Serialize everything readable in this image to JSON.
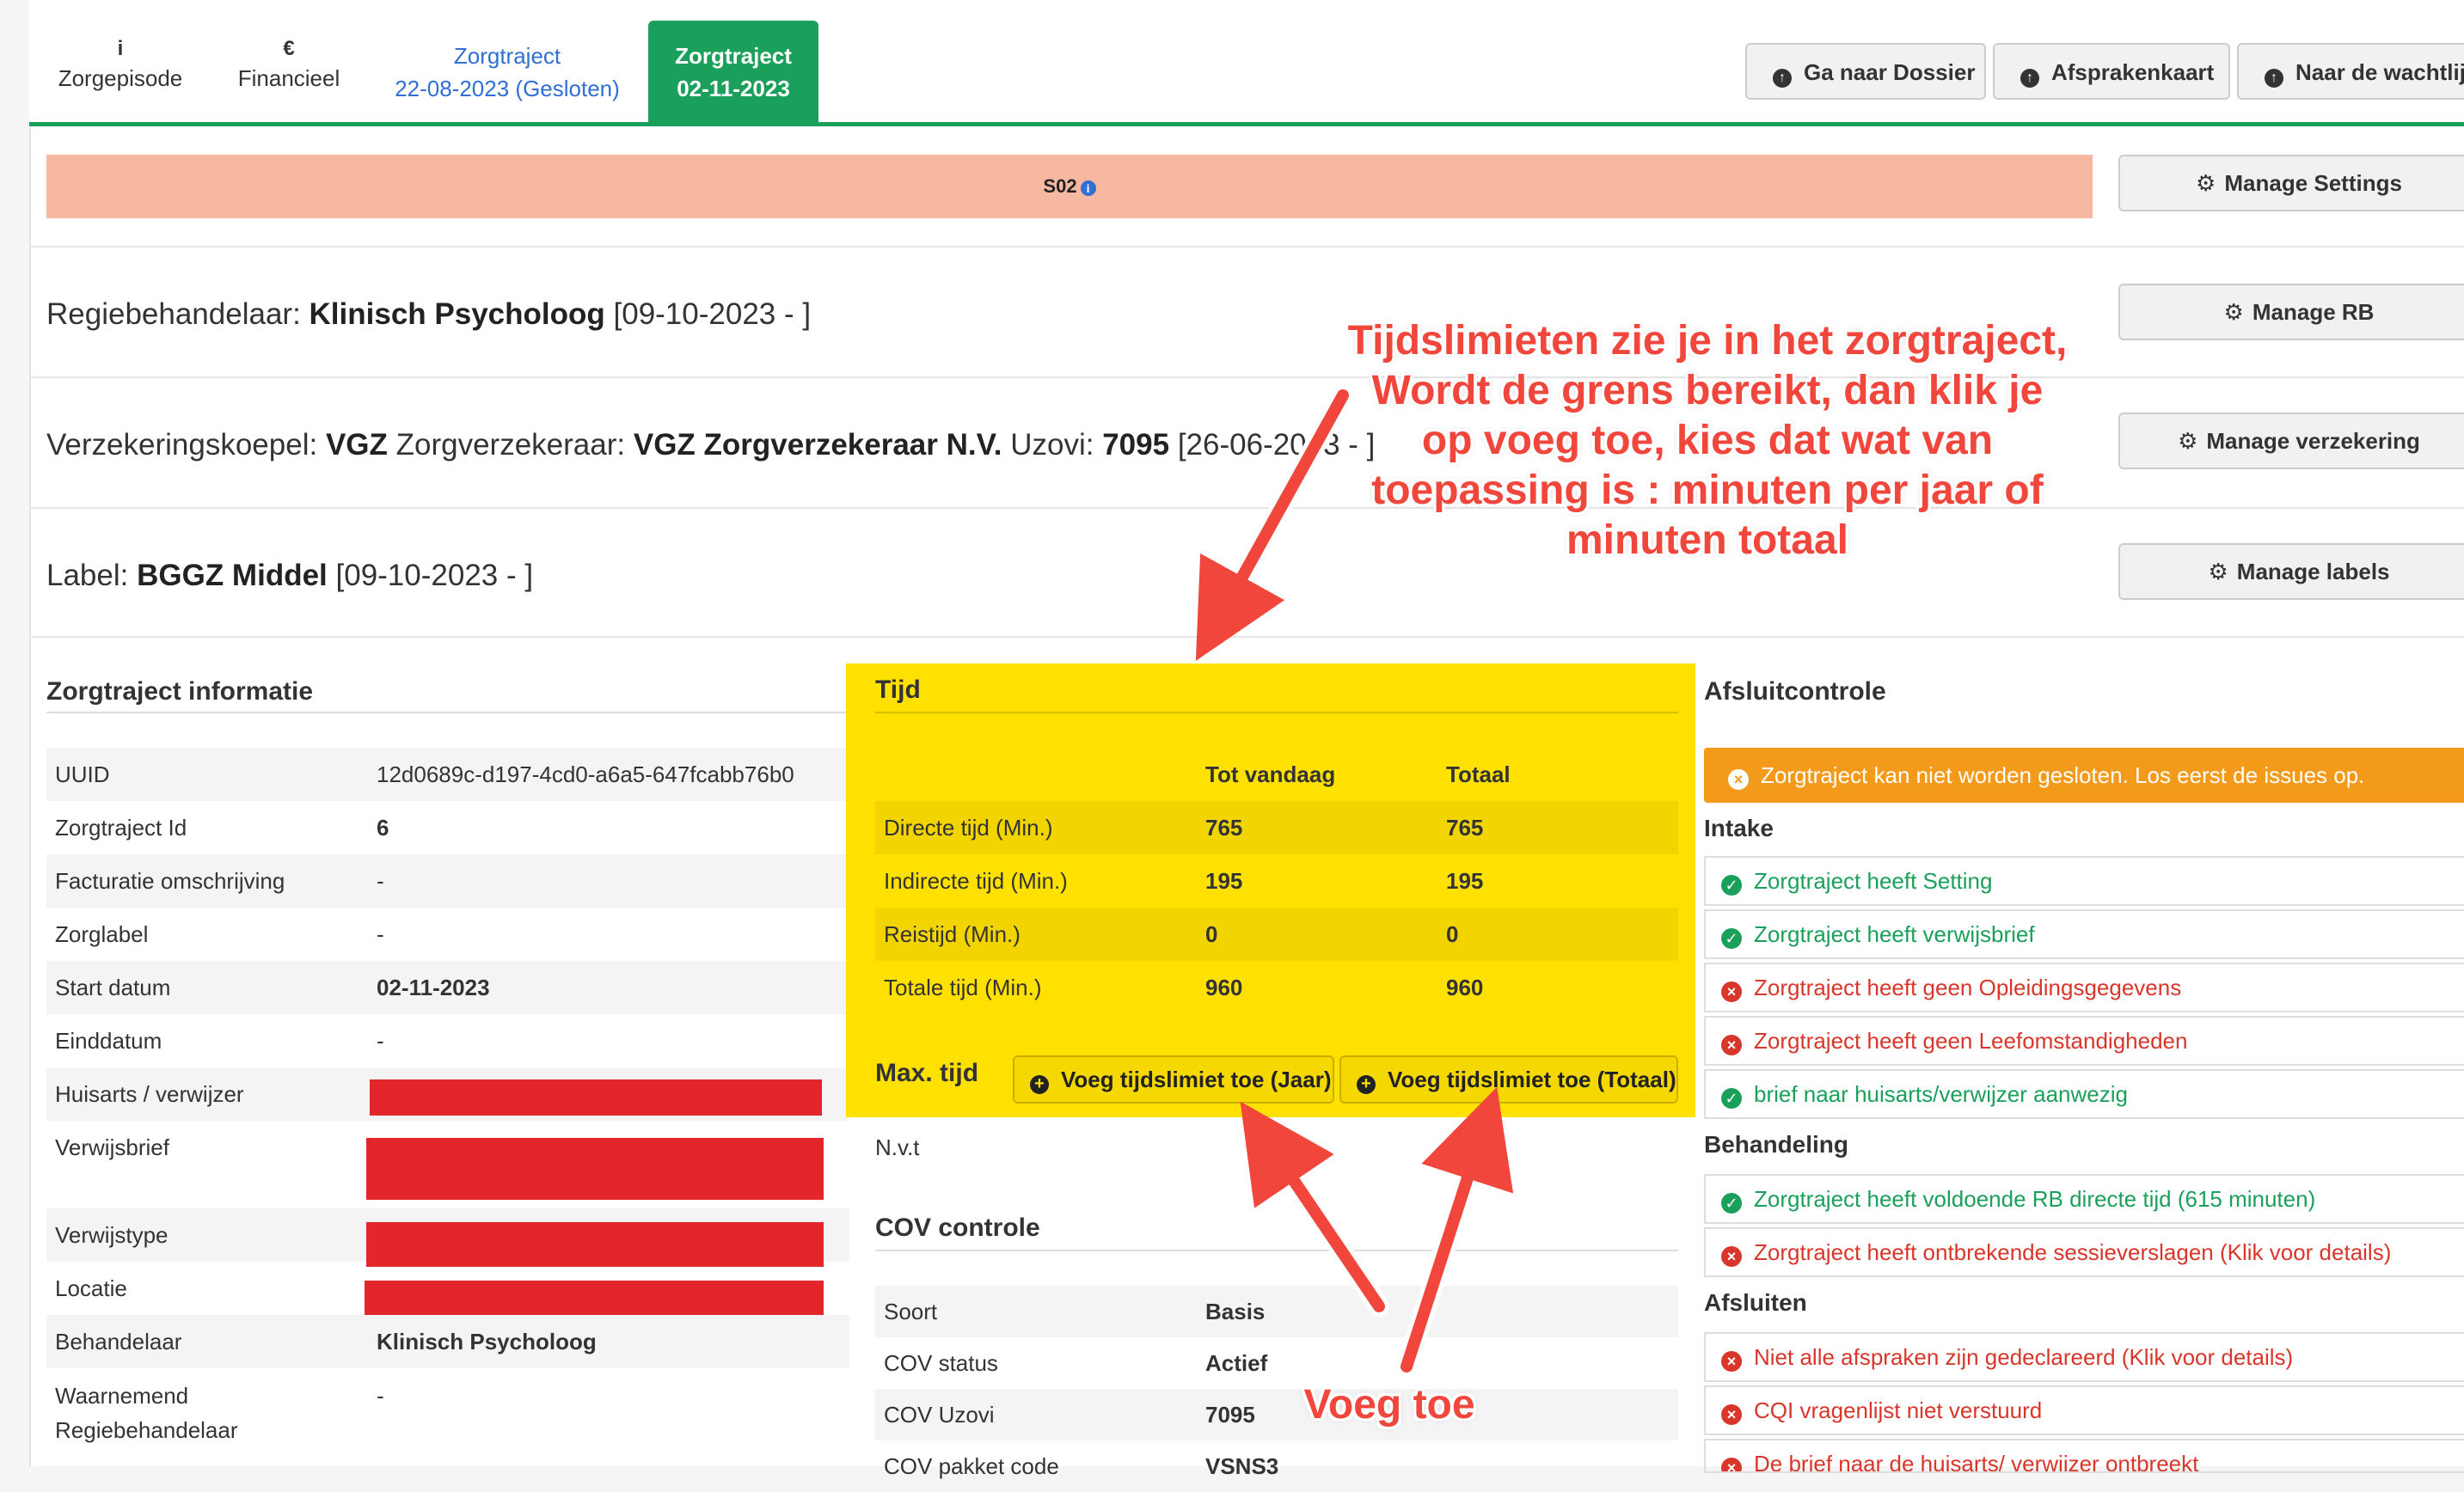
{
  "tabs": {
    "zorgepisode": {
      "icon": "i",
      "label": "Zorgepisode"
    },
    "financieel": {
      "icon": "€",
      "label": "Financieel"
    },
    "zorgtraject_old": {
      "line1": "Zorgtraject",
      "line2": "22-08-2023 (Gesloten)"
    },
    "zorgtraject_active": {
      "line1": "Zorgtraject",
      "line2": "02-11-2023"
    }
  },
  "top_buttons": {
    "dossier": "Ga naar Dossier",
    "afspraken": "Afsprakenkaart",
    "wachtlijst": "Naar de wachtlijst"
  },
  "setting_badge": "S02",
  "manage": {
    "settings": "Manage Settings",
    "rb": "Manage RB",
    "verzekering": "Manage verzekering",
    "labels": "Manage labels"
  },
  "regie": {
    "label": "Regiebehandelaar:",
    "value": "Klinisch Psycholoog",
    "date": "[09-10-2023 - ]"
  },
  "verzekering": {
    "koepel_label": "Verzekeringskoepel:",
    "koepel": "VGZ",
    "verz_label": "Zorgverzekeraar:",
    "verz": "VGZ Zorgverzekeraar N.V.",
    "uzovi_label": "Uzovi:",
    "uzovi": "7095",
    "date": "[26-06-2023 - ]"
  },
  "label": {
    "label": "Label:",
    "value": "BGGZ Middel",
    "date": "[09-10-2023 - ]"
  },
  "zorgtraject_info": {
    "title": "Zorgtraject informatie",
    "rows": [
      {
        "k": "UUID",
        "v": "12d0689c-d197-4cd0-a6a5-647fcabb76b0"
      },
      {
        "k": "Zorgtraject Id",
        "v": "6"
      },
      {
        "k": "Facturatie omschrijving",
        "v": "-"
      },
      {
        "k": "Zorglabel",
        "v": "-"
      },
      {
        "k": "Start datum",
        "v": "02-11-2023"
      },
      {
        "k": "Einddatum",
        "v": "-"
      },
      {
        "k": "Huisarts / verwijzer",
        "v": ""
      },
      {
        "k": "Verwijsbrief",
        "v": ""
      },
      {
        "k": "Verwijstype",
        "v": ""
      },
      {
        "k": "Locatie",
        "v": ""
      },
      {
        "k": "Behandelaar",
        "v": "Klinisch Psycholoog"
      },
      {
        "k": "Waarnemend",
        "k2": "Regiebehandelaar",
        "v": "-"
      }
    ]
  },
  "tijd": {
    "title": "Tijd",
    "head": {
      "c1": "Tot vandaag",
      "c2": "Totaal"
    },
    "rows": [
      {
        "k": "Directe tijd (Min.)",
        "c1": "765",
        "c2": "765"
      },
      {
        "k": "Indirecte tijd (Min.)",
        "c1": "195",
        "c2": "195"
      },
      {
        "k": "Reistijd (Min.)",
        "c1": "0",
        "c2": "0"
      },
      {
        "k": "Totale tijd (Min.)",
        "c1": "960",
        "c2": "960"
      }
    ],
    "max_label": "Max. tijd",
    "btn_jaar": "Voeg tijdslimiet toe (Jaar)",
    "btn_totaal": "Voeg tijdslimiet toe (Totaal)",
    "nvt": "N.v.t"
  },
  "cov": {
    "title": "COV controle",
    "rows": [
      {
        "k": "Soort",
        "v": "Basis"
      },
      {
        "k": "COV status",
        "v": "Actief"
      },
      {
        "k": "COV Uzovi",
        "v": "7095"
      },
      {
        "k": "COV pakket code",
        "v": "VSNS3"
      }
    ]
  },
  "afsluit": {
    "title": "Afsluitcontrole",
    "alert": "Zorgtraject kan niet worden gesloten. Los eerst de issues op.",
    "intake_label": "Intake",
    "intake": [
      {
        "status": "ok",
        "text": "Zorgtraject heeft Setting"
      },
      {
        "status": "ok",
        "text": "Zorgtraject heeft verwijsbrief"
      },
      {
        "status": "bad",
        "text": "Zorgtraject heeft geen Opleidingsgegevens"
      },
      {
        "status": "bad",
        "text": "Zorgtraject heeft geen Leefomstandigheden"
      },
      {
        "status": "ok",
        "text": "brief naar huisarts/verwijzer aanwezig"
      }
    ],
    "behandeling_label": "Behandeling",
    "behandeling": [
      {
        "status": "ok",
        "text": "Zorgtraject heeft voldoende RB directe tijd (615 minuten)"
      },
      {
        "status": "bad",
        "text": "Zorgtraject heeft ontbrekende sessieverslagen (Klik voor details)"
      }
    ],
    "afsluiten_label": "Afsluiten",
    "afsluiten": [
      {
        "status": "bad",
        "text": "Niet alle afspraken zijn gedeclareerd (Klik voor details)"
      },
      {
        "status": "bad",
        "text": "CQI vragenlijst niet verstuurd"
      },
      {
        "status": "bad",
        "text": "De brief naar de huisarts/ verwijzer ontbreekt"
      }
    ]
  },
  "annotation": {
    "lines": [
      "Tijdslimieten zie je in het zorgtraject,",
      "Wordt de grens bereikt, dan klik je",
      "op voeg toe, kies dat wat van",
      "toepassing is : minuten per jaar of",
      "minuten totaal"
    ],
    "voeg_toe": "Voeg toe",
    "color": "#f0463c"
  },
  "colors": {
    "green": "#1aa05a",
    "salmon": "#f6b8a0",
    "yellow": "#ffe100",
    "orange": "#f39a1a",
    "red": "#d9362b"
  }
}
